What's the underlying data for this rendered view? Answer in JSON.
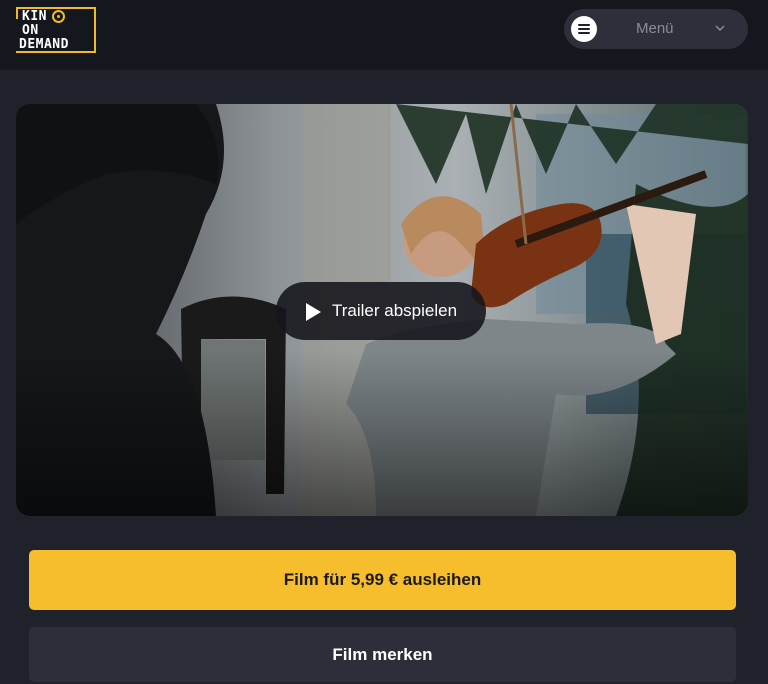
{
  "header": {
    "logo": {
      "line1": "KIN",
      "line2": "ON",
      "line3": "DEMAND"
    },
    "menu": {
      "label": "Menü",
      "icon": "menu-lines-icon",
      "chevron": "chevron-down-icon"
    }
  },
  "hero": {
    "play_label": "Trailer abspielen",
    "play_icon": "play-icon"
  },
  "actions": {
    "rent_label": "Film für 5,99 € ausleihen",
    "save_label": "Film merken"
  },
  "colors": {
    "accent": "#f6bd2c",
    "background": "#1f212b",
    "header": "#15171e"
  }
}
